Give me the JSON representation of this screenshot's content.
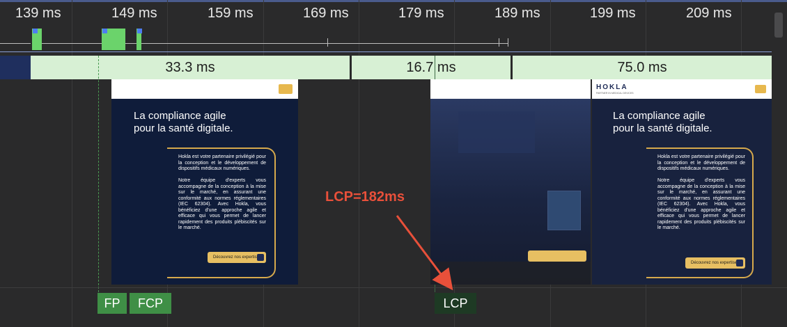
{
  "timeline": {
    "ticks": [
      "139 ms",
      "149 ms",
      "159 ms",
      "169 ms",
      "179 ms",
      "189 ms",
      "199 ms",
      "209 ms"
    ]
  },
  "frames": {
    "durations": [
      "33.3 ms",
      "16.7 ms",
      "75.0 ms"
    ]
  },
  "screenshot": {
    "logo": "HOKLA",
    "logo_tagline": "PARTNER IN MEDICAL DEVICES",
    "headline_line1": "La compliance agile",
    "headline_line2": "pour la santé digitale.",
    "para1": "Hokla est votre partenaire privilégié pour la conception et le développement de dispositifs médicaux numériques.",
    "para2": "Notre équipe d'experts vous accompagne de la conception à la mise sur le marché, en assurant une conformité aux normes réglementaires (IEC 62304). Avec Hokla, vous bénéficiez d'une approche agile et efficace qui vous permet de lancer rapidement des produits plébiscités sur le marché.",
    "cta": "Découvrez nos expertises"
  },
  "markers": {
    "fp": "FP",
    "fcp": "FCP",
    "lcp": "LCP"
  },
  "annotation": {
    "text": "LCP=182ms",
    "color": "#e8503a"
  },
  "colors": {
    "frame_green": "#d7f0d4",
    "marker_green": "#3f8f46",
    "lcp_badge": "#1e3a24",
    "cta_gold": "#e7bf62"
  }
}
